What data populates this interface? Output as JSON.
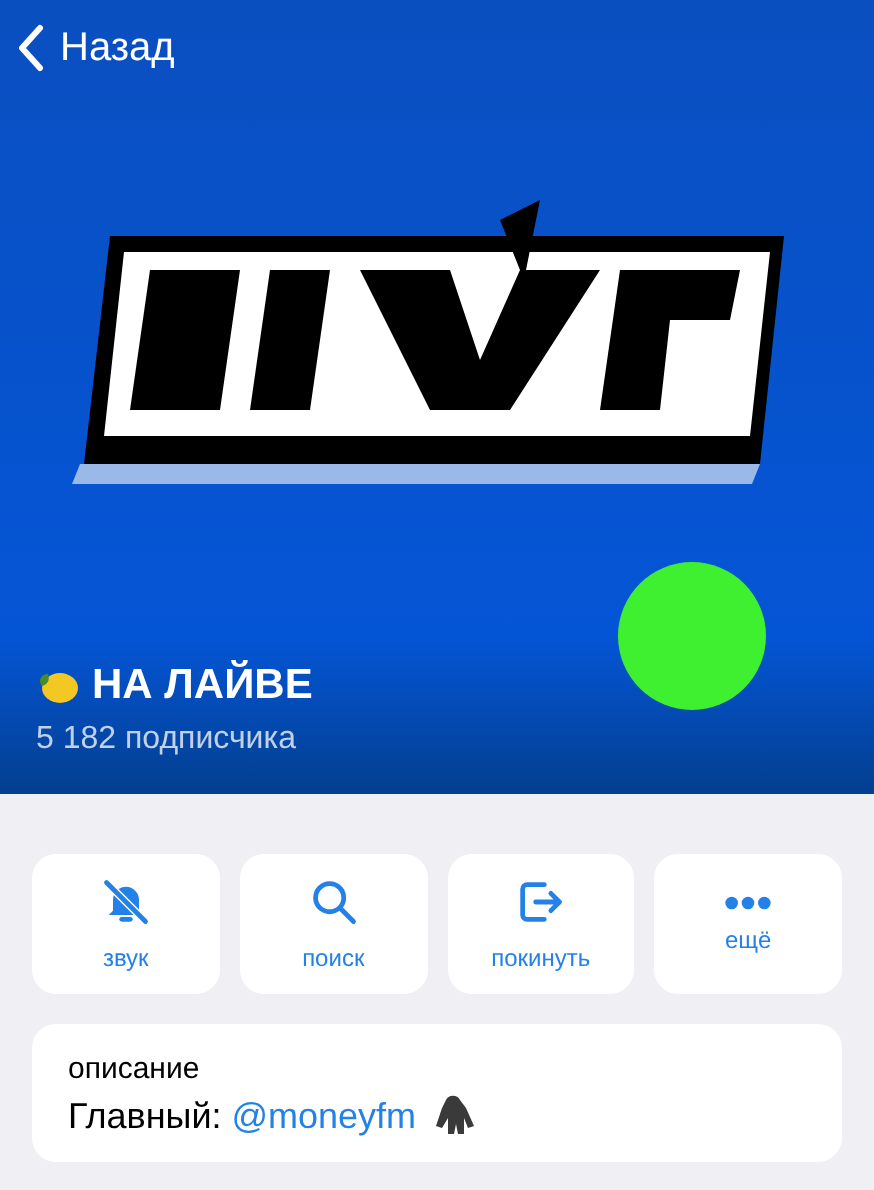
{
  "nav": {
    "back_label": "Назад"
  },
  "header": {
    "title": "НА ЛАЙВЕ",
    "subtitle": "5 182 подписчика"
  },
  "actions": [
    {
      "kind": "mute",
      "label": "звук"
    },
    {
      "kind": "search",
      "label": "поиск"
    },
    {
      "kind": "leave",
      "label": "покинуть"
    },
    {
      "kind": "more",
      "label": "ещё"
    }
  ],
  "about": {
    "label": "описание",
    "text": "Главный: ",
    "link": "@moneyfm"
  }
}
